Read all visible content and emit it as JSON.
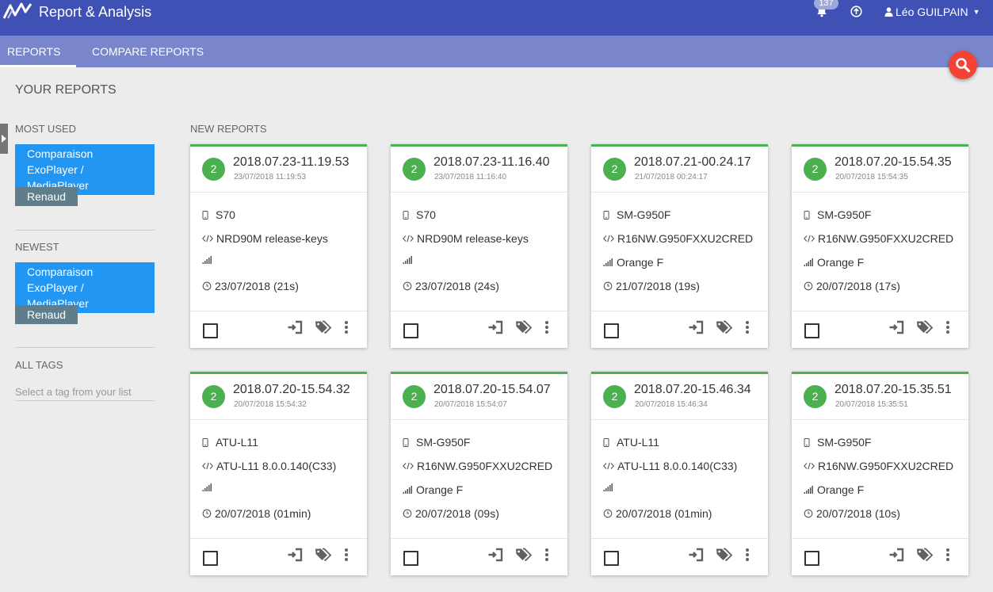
{
  "header": {
    "app_title": "Report & Analysis",
    "notification_count": "137",
    "user_name": "Léo GUILPAIN",
    "icons": [
      "app-logo-icon",
      "bell-icon",
      "upload-icon",
      "user-icon",
      "caret-down-icon"
    ]
  },
  "tabs": [
    {
      "label": "REPORTS",
      "active": true
    },
    {
      "label": "COMPARE REPORTS",
      "active": false
    }
  ],
  "page_title": "YOUR REPORTS",
  "sidebar": {
    "most_used": {
      "label": "MOST USED",
      "items": [
        "Comparaison ExoPlayer / MediaPlayer",
        "Renaud"
      ]
    },
    "newest": {
      "label": "NEWEST",
      "items": [
        "Comparaison ExoPlayer / MediaPlayer",
        "Renaud"
      ]
    },
    "all_tags": {
      "label": "ALL TAGS",
      "placeholder": "Select a tag from your list"
    }
  },
  "new_reports_label": "NEW REPORTS",
  "colors": {
    "header": "#3f51b5",
    "tabbar": "#7986cb",
    "accent_green": "#4caf50",
    "chip_blue": "#2196f3",
    "chip_grey": "#607d8b",
    "fab_red": "#f44336"
  },
  "reports": [
    {
      "badge": "2",
      "title": "2018.07.23-11.19.53",
      "timestamp": "23/07/2018 11:19:53",
      "device": "S70",
      "build": "NRD90M release-keys",
      "network": "",
      "date": "23/07/2018 (21s)"
    },
    {
      "badge": "2",
      "title": "2018.07.23-11.16.40",
      "timestamp": "23/07/2018 11:16:40",
      "device": "S70",
      "build": "NRD90M release-keys",
      "network": "",
      "date": "23/07/2018 (24s)"
    },
    {
      "badge": "2",
      "title": "2018.07.21-00.24.17",
      "timestamp": "21/07/2018 00:24:17",
      "device": "SM-G950F",
      "build": "R16NW.G950FXXU2CRED",
      "network": "Orange F",
      "date": "21/07/2018 (19s)"
    },
    {
      "badge": "2",
      "title": "2018.07.20-15.54.35",
      "timestamp": "20/07/2018 15:54:35",
      "device": "SM-G950F",
      "build": "R16NW.G950FXXU2CRED",
      "network": "Orange F",
      "date": "20/07/2018 (17s)"
    },
    {
      "badge": "2",
      "title": "2018.07.20-15.54.32",
      "timestamp": "20/07/2018 15:54:32",
      "device": "ATU-L11",
      "build": "ATU-L11 8.0.0.140(C33)",
      "network": "",
      "date": "20/07/2018 (01min)"
    },
    {
      "badge": "2",
      "title": "2018.07.20-15.54.07",
      "timestamp": "20/07/2018 15:54:07",
      "device": "SM-G950F",
      "build": "R16NW.G950FXXU2CRED",
      "network": "Orange F",
      "date": "20/07/2018 (09s)"
    },
    {
      "badge": "2",
      "title": "2018.07.20-15.46.34",
      "timestamp": "20/07/2018 15:46:34",
      "device": "ATU-L11",
      "build": "ATU-L11 8.0.0.140(C33)",
      "network": "",
      "date": "20/07/2018 (01min)"
    },
    {
      "badge": "2",
      "title": "2018.07.20-15.35.51",
      "timestamp": "20/07/2018 15:35:51",
      "device": "SM-G950F",
      "build": "R16NW.G950FXXU2CRED",
      "network": "Orange F",
      "date": "20/07/2018 (10s)"
    }
  ]
}
